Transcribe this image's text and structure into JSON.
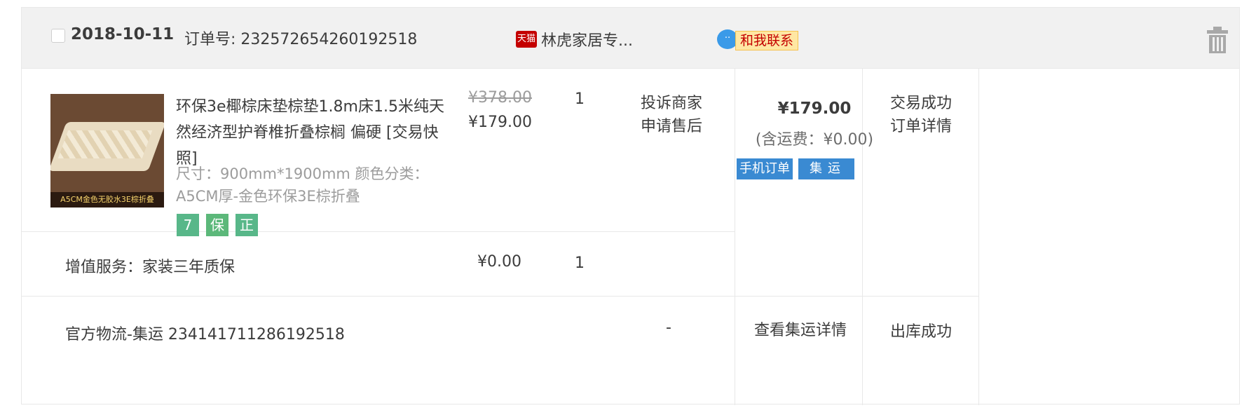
{
  "order": {
    "date": "2018-10-11",
    "order_no_text": "订单号: 232572654260192518",
    "shop_badge": "天猫",
    "shop_name": "林虎家居专...",
    "contact_label": "和我联系"
  },
  "product": {
    "image_caption": "A5CM金色无胶水3E棕折叠",
    "title": "环保3e椰棕床垫棕垫1.8m床1.5米纯天然经济型护脊椎折叠棕榈 偏硬 [交易快照]",
    "sku": "尺寸：900mm*1900mm  颜色分类：A5CM厚-金色环保3E棕折叠",
    "badges": [
      "7",
      "保",
      "正"
    ],
    "original_price": "¥378.00",
    "price": "¥179.00",
    "quantity": "1",
    "actions": [
      "投诉商家",
      "申请售后"
    ]
  },
  "payment": {
    "total": "¥179.00",
    "shipping": "(含运费：¥0.00)",
    "tags": [
      "手机订单",
      "集运"
    ]
  },
  "status": {
    "text": "交易成功",
    "detail_link": "订单详情"
  },
  "service": {
    "label": "增值服务：家装三年质保",
    "price": "¥0.00",
    "quantity": "1"
  },
  "logistics": {
    "label": "官方物流-集运  234141711286192518",
    "placeholder": "-",
    "detail_link": "查看集运详情",
    "status": "出库成功"
  }
}
